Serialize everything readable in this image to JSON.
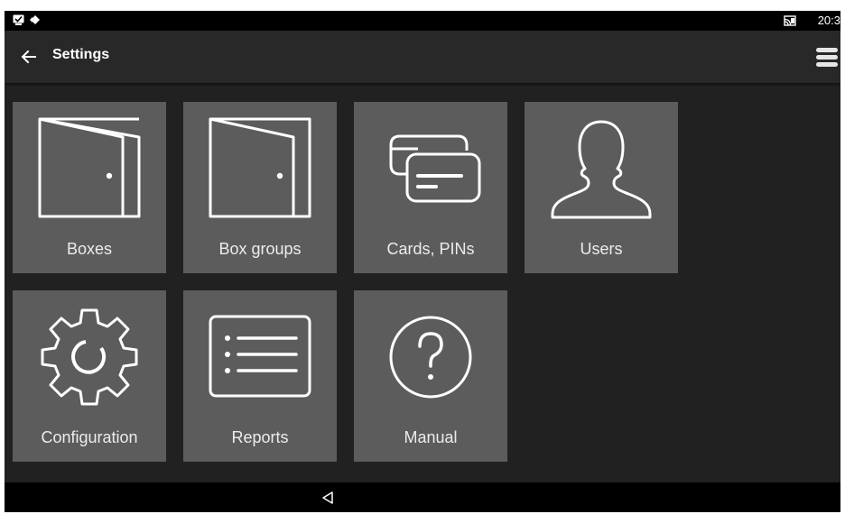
{
  "status_bar": {
    "time": "20:3",
    "left_icons": [
      "checkbox-notification-icon",
      "diamond-arrows-icon"
    ],
    "right_icons": [
      "cast-icon"
    ]
  },
  "app_bar": {
    "title": "Settings",
    "back_icon": "arrow-left-icon",
    "menu_icon": "hamburger-menu-icon"
  },
  "tiles": [
    {
      "label": "Boxes",
      "icon": "door-icon"
    },
    {
      "label": "Box groups",
      "icon": "door-icon"
    },
    {
      "label": "Cards, PINs",
      "icon": "cards-icon"
    },
    {
      "label": "Users",
      "icon": "user-silhouette-icon"
    },
    {
      "label": "Configuration",
      "icon": "gear-icon"
    },
    {
      "label": "Reports",
      "icon": "list-icon"
    },
    {
      "label": "Manual",
      "icon": "help-circle-icon"
    }
  ],
  "nav_bar": {
    "back_icon": "triangle-back-icon"
  },
  "colors": {
    "background": "#212121",
    "app_bar": "#282828",
    "tile": "#5c5c5c",
    "icon_stroke": "#ffffff",
    "label": "#ececec"
  }
}
